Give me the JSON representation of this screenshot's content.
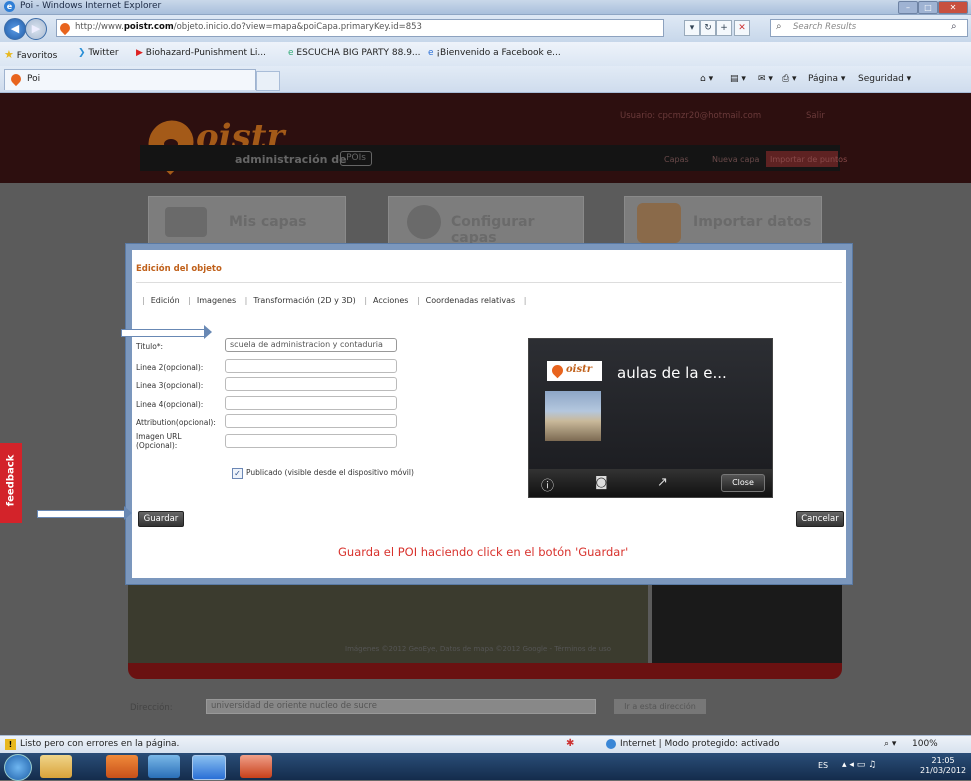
{
  "window": {
    "title": "Poi - Windows Internet Explorer"
  },
  "address_bar": {
    "url_prefix": "http://www.",
    "url_domain": "poistr.com",
    "url_rest": "/objeto.inicio.do?view=mapa&poiCapa.primaryKey.id=853",
    "search_placeholder": "Search Results"
  },
  "favorites_bar": {
    "label": "Favoritos",
    "items": [
      "Twitter",
      "Biohazard-Punishment Li...",
      "ESCUCHA BIG PARTY 88.9...",
      "¡Bienvenido a Facebook e..."
    ]
  },
  "tab_row": {
    "active_tab": "Poi",
    "commands": {
      "page": "Página ▾",
      "security": "Seguridad ▾"
    }
  },
  "site": {
    "logo_text": "oistr",
    "subtitle": "administración de",
    "subtitle_badge": "POIs",
    "user_email": "Usuario: cpcmzr20@hotmail.com",
    "logout": "Salir",
    "nav": [
      "Capas",
      "Nueva capa",
      "Importar de puntos"
    ],
    "cards": [
      "Mis capas",
      "Configurar capas",
      "Importar datos"
    ],
    "feedback": "feedback",
    "map_note": "Imágenes ©2012 GeoEye, Datos de mapa ©2012 Google - Términos de uso",
    "direccion_label": "Dirección:",
    "direccion_value": "universidad de oriente nucleo de sucre",
    "direccion_button": "Ir a esta dirección"
  },
  "modal": {
    "title": "Edición del objeto",
    "tabs": [
      "Edición",
      "Imagenes",
      "Transformación (2D y 3D)",
      "Acciones",
      "Coordenadas relativas"
    ],
    "fields": [
      {
        "label": "Titulo*:",
        "value": "scuela de administracion y contaduria"
      },
      {
        "label": "Linea 2(opcional):",
        "value": ""
      },
      {
        "label": "Linea 3(opcional):",
        "value": ""
      },
      {
        "label": "Linea 4(opcional):",
        "value": ""
      },
      {
        "label": "Attribution(opcional):",
        "value": ""
      },
      {
        "label": "Imagen URL (Opcional):",
        "value": ""
      }
    ],
    "published_label": "Publicado (visible desde el dispositivo móvil)",
    "published_checked": true,
    "preview": {
      "logo": "oistr",
      "title": "aulas de la e...",
      "close": "Close"
    },
    "save_button": "Guardar",
    "cancel_button": "Cancelar",
    "hint": "Guarda el POI haciendo click en el botón 'Guardar'"
  },
  "status_bar": {
    "message": "Listo pero con errores en la página.",
    "zone": "Internet | Modo protegido: activado",
    "zoom": "100%"
  },
  "taskbar": {
    "language": "ES",
    "time": "21:05",
    "date": "21/03/2012"
  },
  "colors": {
    "accent_orange": "#c0611b",
    "hint_red": "#d8322d",
    "feedback_red": "#d3232a",
    "modal_border": "#7b97bd"
  }
}
